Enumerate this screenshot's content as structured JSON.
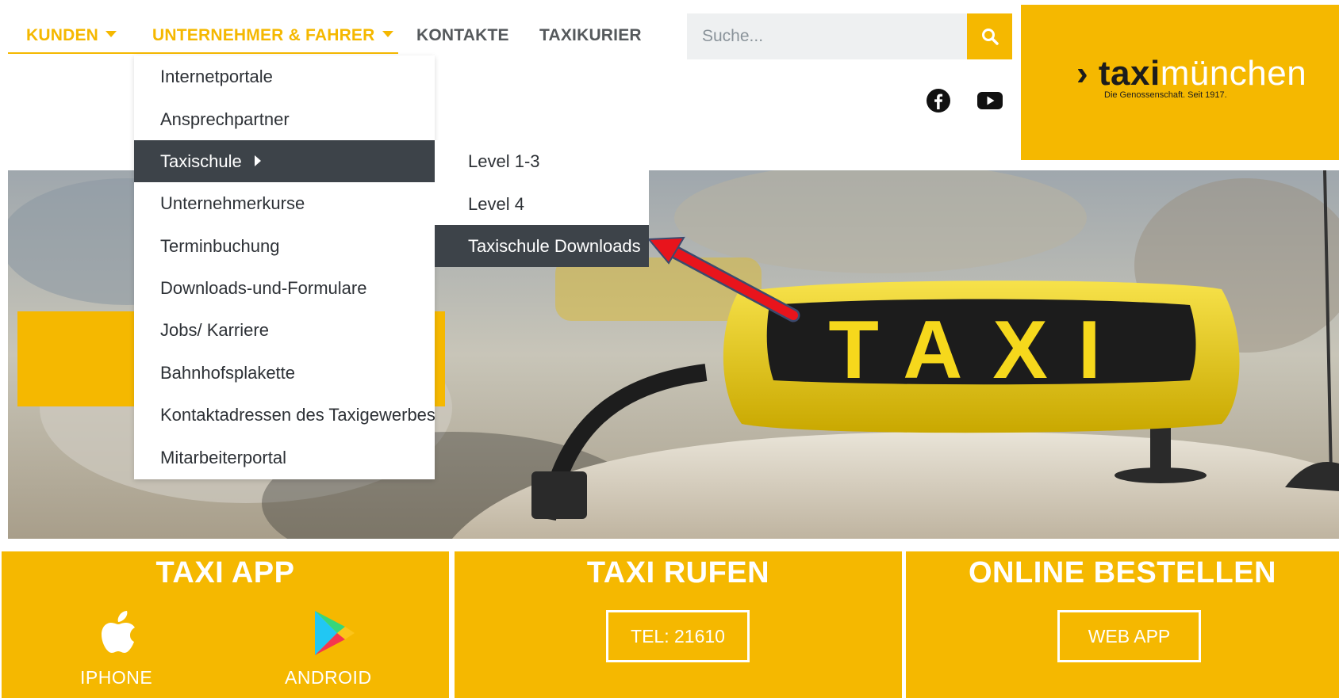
{
  "nav": {
    "kunden": "KUNDEN",
    "unternehmer": "UNTERNEHMER & FAHRER",
    "kontakte": "KONTAKTE",
    "taxikurier": "TAXIKURIER"
  },
  "search": {
    "placeholder": "Suche..."
  },
  "logo": {
    "word1": "› taxi",
    "word2": "münchen",
    "tagline": "Die Genossenschaft. Seit 1917."
  },
  "dropdown": {
    "items": [
      "Internetportale",
      "Ansprechpartner",
      "Taxischule",
      "Unternehmerkurse",
      "Terminbuchung",
      "Downloads-und-Formulare",
      "Jobs/ Karriere",
      "Bahnhofsplakette",
      "Kontaktadressen des Taxigewerbes",
      "Mitarbeiterportal"
    ]
  },
  "submenu": {
    "items": [
      "Level 1-3",
      "Level 4",
      "Taxischule Downloads"
    ]
  },
  "hero": {
    "sign_text": "TAXI"
  },
  "boxes": {
    "app": {
      "title": "TAXI APP",
      "iphone": "IPHONE",
      "android": "ANDROID"
    },
    "call": {
      "title": "TAXI RUFEN",
      "button": "TEL: 21610"
    },
    "order": {
      "title": "ONLINE BESTELLEN",
      "button": "WEB APP"
    }
  },
  "colors": {
    "brand_yellow": "#f5b800",
    "menu_dark": "#3d4349",
    "annotation_arrow": "#e8141c"
  }
}
